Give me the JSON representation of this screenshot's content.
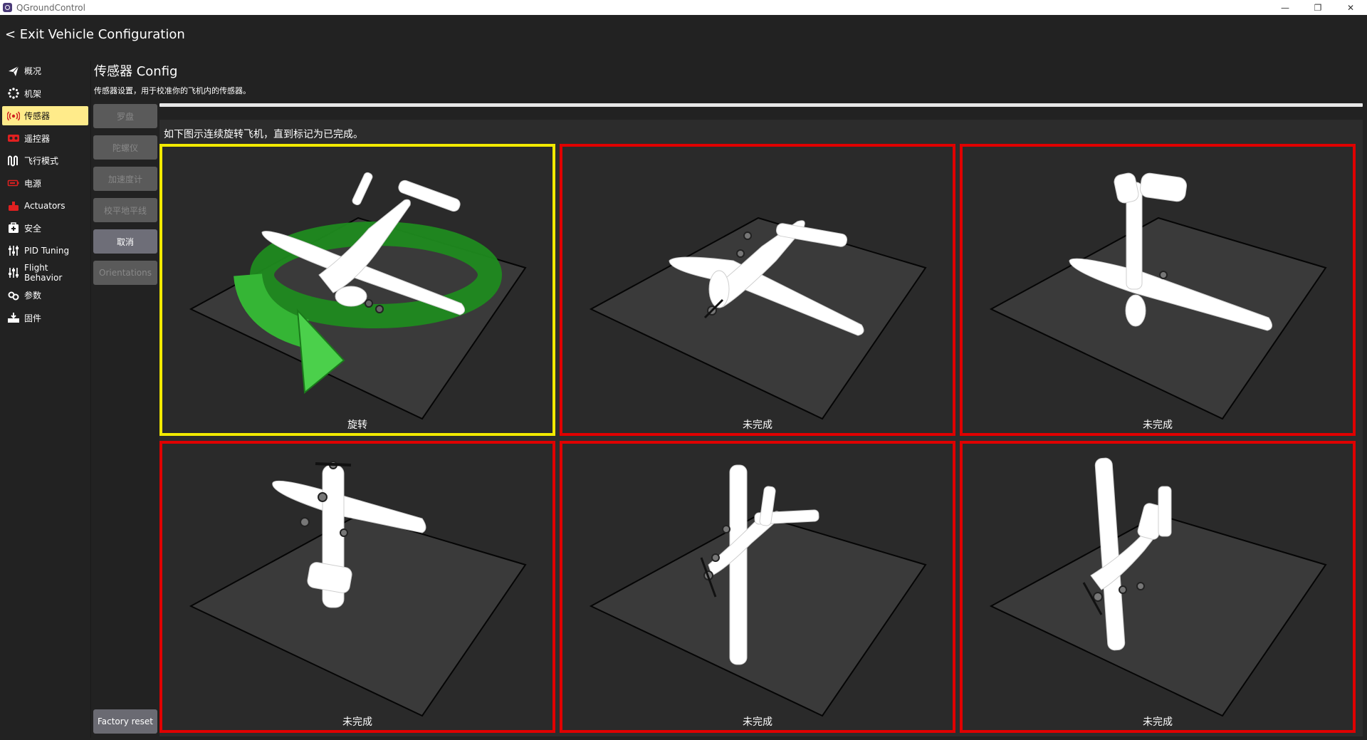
{
  "window": {
    "title": "QGroundControl",
    "controls": {
      "minimize": "—",
      "restore": "❐",
      "close": "✕"
    }
  },
  "header": {
    "exit_label": "< Exit Vehicle Configuration"
  },
  "sidebar": {
    "items": [
      {
        "label": "概况",
        "icon": "paper-plane-icon"
      },
      {
        "label": "机架",
        "icon": "airframe-icon"
      },
      {
        "label": "传感器",
        "icon": "sensors-icon",
        "active": true
      },
      {
        "label": "遥控器",
        "icon": "radio-icon"
      },
      {
        "label": "飞行模式",
        "icon": "flight-modes-icon"
      },
      {
        "label": "电源",
        "icon": "battery-icon"
      },
      {
        "label": "Actuators",
        "icon": "actuators-icon"
      },
      {
        "label": "安全",
        "icon": "safety-icon"
      },
      {
        "label": "PID Tuning",
        "icon": "tuning-icon"
      },
      {
        "label": "Flight Behavior",
        "icon": "tuning-icon"
      },
      {
        "label": "参数",
        "icon": "parameters-icon"
      },
      {
        "label": "固件",
        "icon": "firmware-icon"
      }
    ],
    "active_color": "#ffeb8a"
  },
  "page": {
    "title": "传感器 Config",
    "description": "传感器设置，用于校准你的飞机内的传感器。"
  },
  "buttons": {
    "compass": "罗盘",
    "gyroscope": "陀螺仪",
    "accelerometer": "加速度计",
    "level_horizon": "校平地平线",
    "cancel": "取消",
    "orientations": "Orientations",
    "factory_reset": "Factory reset"
  },
  "calibration": {
    "instruction": "如下图示连续旋转飞机，直到标记为已完成。",
    "tiles": [
      {
        "status": "旋转",
        "state": "current"
      },
      {
        "status": "未完成",
        "state": "incomplete"
      },
      {
        "status": "未完成",
        "state": "incomplete"
      },
      {
        "status": "未完成",
        "state": "incomplete"
      },
      {
        "status": "未完成",
        "state": "incomplete"
      },
      {
        "status": "未完成",
        "state": "incomplete"
      }
    ],
    "colors": {
      "current": "#f2ea00",
      "incomplete": "#e00000",
      "rotate_arrow": "#22a022"
    }
  }
}
